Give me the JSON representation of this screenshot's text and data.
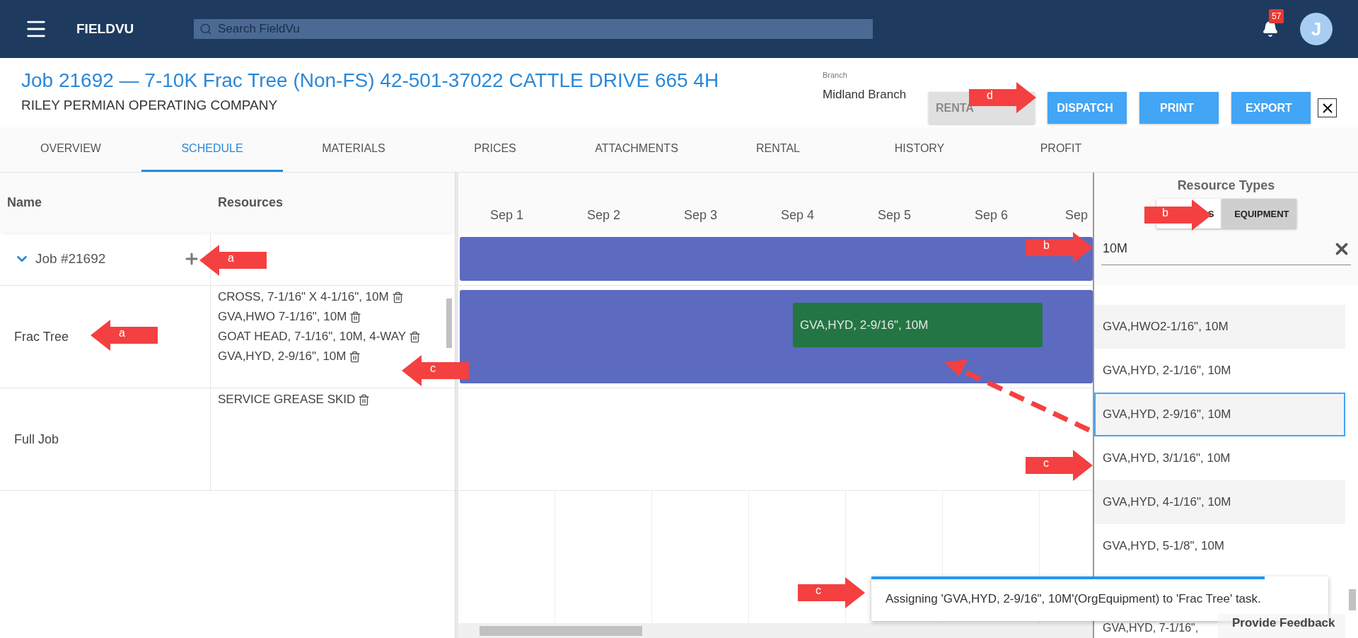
{
  "header": {
    "brand": "FIELDVU",
    "search": {
      "placeholder": "Search FieldVu"
    },
    "notifications": {
      "count": "57"
    },
    "avatar": {
      "initial": "J"
    }
  },
  "job": {
    "title": "Job 21692 — 7-10K Frac Tree (Non-FS) 42-501-37022 CATTLE DRIVE 665 4H",
    "company": "RILEY PERMIAN OPERATING COMPANY",
    "branch": {
      "label": "Branch",
      "value": "Midland Branch"
    },
    "actions": [
      {
        "label": "RENTA",
        "disabled": true
      },
      {
        "label": "DISPATCH",
        "disabled": false
      },
      {
        "label": "PRINT",
        "disabled": false
      },
      {
        "label": "EXPORT",
        "disabled": false
      }
    ]
  },
  "tabs": [
    {
      "label": "OVERVIEW",
      "selected": false
    },
    {
      "label": "SCHEDULE",
      "selected": true
    },
    {
      "label": "MATERIALS",
      "selected": false
    },
    {
      "label": "PRICES",
      "selected": false
    },
    {
      "label": "ATTACHMENTS",
      "selected": false
    },
    {
      "label": "RENTAL",
      "selected": false
    },
    {
      "label": "HISTORY",
      "selected": false
    },
    {
      "label": "PROFIT",
      "selected": false
    }
  ],
  "schedule": {
    "columns": [
      "Name",
      "Resources"
    ],
    "rows": [
      {
        "kind": "parent",
        "name": "Job #21692",
        "expanded": true
      },
      {
        "kind": "task",
        "name": "Frac Tree",
        "resources": [
          "CROSS, 7-1/16\" X 4-1/16\", 10M",
          "GVA,HWO 7-1/16\", 10M",
          "GOAT HEAD, 7-1/16\", 10M, 4-WAY",
          "GVA,HYD, 2-9/16\", 10M"
        ],
        "assignment": "GVA,HYD, 2-9/16\", 10M"
      },
      {
        "kind": "empty",
        "name": "Full Job",
        "resources": [
          "SERVICE GREASE SKID"
        ]
      }
    ]
  },
  "timeline": {
    "days": [
      "Sep 1",
      "Sep 2",
      "Sep 3",
      "Sep 4",
      "Sep 5",
      "Sep 6",
      "Sep"
    ]
  },
  "resource_panel": {
    "title": "Resource Types",
    "types": [
      {
        "label": "S",
        "selected": false
      },
      {
        "label": "EQUIPMENT",
        "selected": true
      }
    ],
    "search": {
      "value": "10M"
    },
    "items": [
      {
        "label": "GVA,HWO2-1/16\", 10M",
        "selected": false
      },
      {
        "label": "GVA,HYD, 2-1/16\", 10M",
        "selected": false
      },
      {
        "label": "GVA,HYD, 2-9/16\", 10M",
        "selected": true
      },
      {
        "label": "GVA,HYD, 3/1/16\", 10M",
        "selected": false
      },
      {
        "label": "GVA,HYD, 4-1/16\", 10M",
        "selected": false
      },
      {
        "label": "GVA,HYD, 5-1/8\", 10M",
        "selected": false
      },
      {
        "label": "GVA,HYD, 7-1/16\",",
        "selected": false
      }
    ]
  },
  "toast": {
    "message": "Assigning 'GVA,HYD, 2-9/16\", 10M'(OrgEquipment) to 'Frac Tree' task.",
    "level": 0.86
  },
  "feedback": {
    "label": "Provide Feedback"
  },
  "callouts": [
    {
      "label": "d"
    },
    {
      "label": "a"
    },
    {
      "label": "a"
    },
    {
      "label": "c"
    },
    {
      "label": "b"
    },
    {
      "label": "b"
    },
    {
      "label": "c"
    },
    {
      "label": "c"
    }
  ]
}
